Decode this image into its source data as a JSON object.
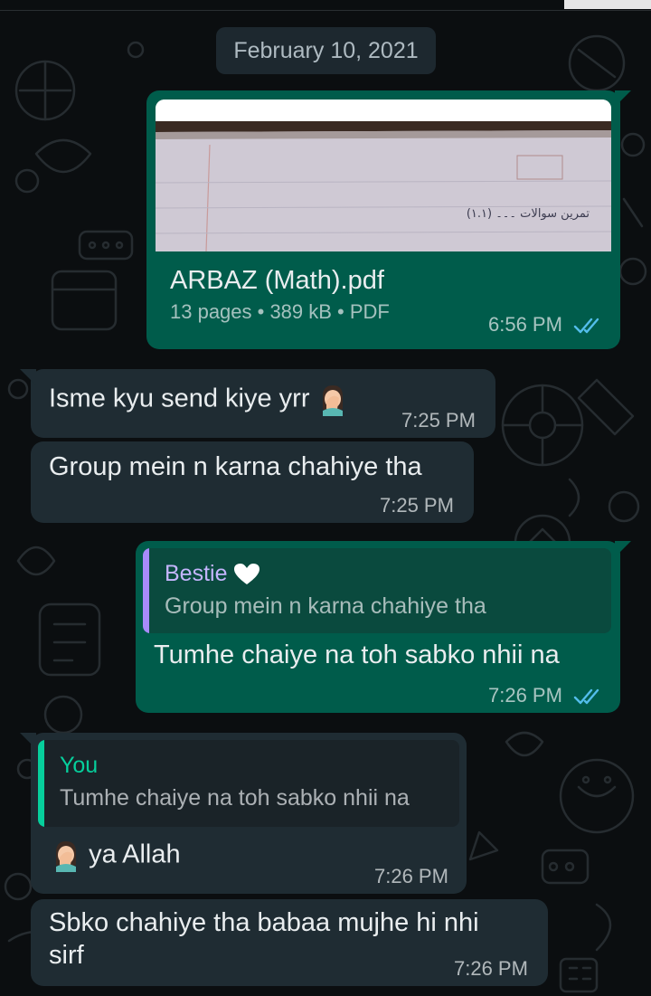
{
  "date_chip": "February 10, 2021",
  "colors": {
    "chat_background": "#0b0e10",
    "incoming_bubble": "#1f2c33",
    "outgoing_bubble": "#005c4b",
    "read_ticks": "#53bdeb",
    "quote_bar_contact": "#a78bfa",
    "quote_bar_you": "#06cf9c"
  },
  "messages": [
    {
      "type": "document",
      "direction": "outgoing",
      "file_name": "ARBAZ (Math).pdf",
      "file_meta": "13 pages • 389 kB • PDF",
      "preview_handwriting": "(۱.۱) تمرین سوالات ۔۔۔",
      "time": "6:56 PM",
      "status_icon": "double-check-read-icon"
    },
    {
      "type": "text",
      "direction": "incoming",
      "text": "Isme kyu send kiye yrr",
      "emoji_icon": "face-palm-emoji-icon",
      "time": "7:25 PM"
    },
    {
      "type": "text",
      "direction": "incoming",
      "text": "Group mein n karna chahiye tha",
      "time": "7:25 PM"
    },
    {
      "type": "reply",
      "direction": "outgoing",
      "quote_name": "Bestie",
      "quote_name_icon": "white-heart-emoji-icon",
      "quote_text": "Group mein n karna chahiye tha",
      "text": "Tumhe chaiye na toh sabko nhii na",
      "time": "7:26 PM",
      "status_icon": "double-check-read-icon"
    },
    {
      "type": "reply",
      "direction": "incoming",
      "quote_name": "You",
      "quote_text": "Tumhe chaiye na toh sabko nhii na",
      "text": "ya Allah",
      "emoji_icon": "face-palm-emoji-icon",
      "time": "7:26 PM"
    },
    {
      "type": "text",
      "direction": "incoming",
      "text_line1": "Sbko chahiye tha babaa mujhe hi nhi",
      "text_line2": "sirf",
      "time": "7:26 PM"
    }
  ]
}
